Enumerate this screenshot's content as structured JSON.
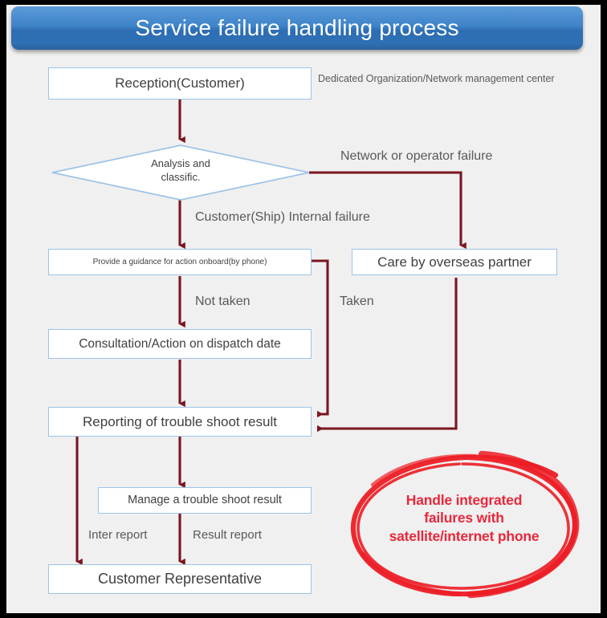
{
  "title": "Service failure handling process",
  "header_note": "Dedicated Organization/Network management center",
  "colors": {
    "banner_blue": "#3f84c9",
    "box_border": "#9cc3e9",
    "arrow_red": "#7a1620",
    "annotation_red": "#e8283c",
    "canvas_bg": "#f0f0f0",
    "frame": "#000000"
  },
  "nodes": {
    "reception": "Reception(Customer)",
    "decision_line1": "Analysis and",
    "decision_line2": "classific.",
    "guidance": "Provide a guidance for action onboard(by phone)",
    "overseas": "Care by overseas partner",
    "consultation": "Consultation/Action on dispatch date",
    "reporting": "Reporting of trouble shoot result",
    "manage": "Manage a trouble shoot  result",
    "customer_rep": "Customer Representative"
  },
  "edge_labels": {
    "network_failure": "Network or operator failure",
    "internal_failure": "Customer(Ship) Internal failure",
    "not_taken": "Not taken",
    "taken": "Taken",
    "inter_report": "Inter report",
    "result_report": "Result report"
  },
  "annotation": {
    "line1": "Handle integrated",
    "line2": "failures with",
    "line3": "satellite/internet phone"
  }
}
